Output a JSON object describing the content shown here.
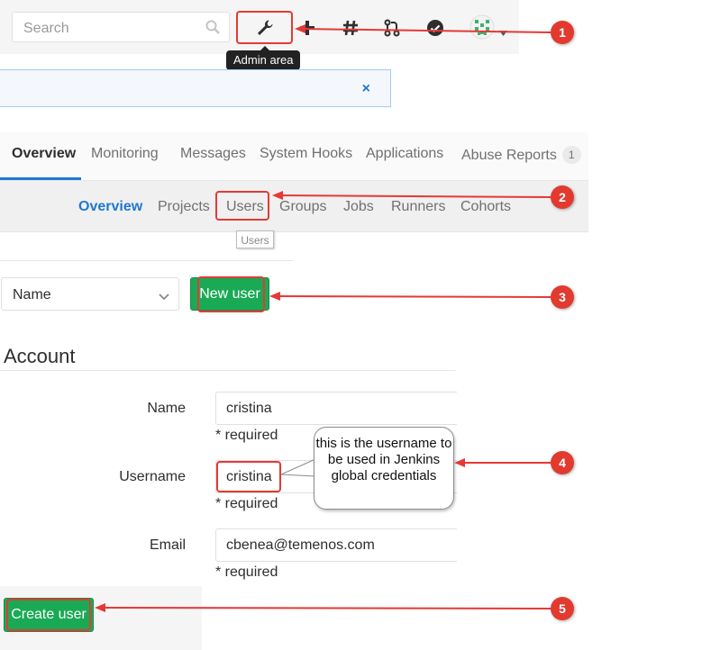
{
  "header": {
    "search_placeholder": "Search",
    "admin_tooltip": "Admin area",
    "icons": [
      "search-icon",
      "wrench-icon",
      "plus-icon",
      "hash-icon",
      "merge-request-icon",
      "todo-check-icon",
      "avatar-icon",
      "caret-down-icon"
    ]
  },
  "alert": {
    "close": "×"
  },
  "tabs": [
    {
      "label": "Overview",
      "active": true
    },
    {
      "label": "Monitoring"
    },
    {
      "label": "Messages"
    },
    {
      "label": "System Hooks"
    },
    {
      "label": "Applications"
    },
    {
      "label": "Abuse Reports",
      "badge": "1"
    }
  ],
  "subtabs": [
    {
      "label": "Overview",
      "active": true
    },
    {
      "label": "Projects"
    },
    {
      "label": "Users"
    },
    {
      "label": "Groups"
    },
    {
      "label": "Jobs"
    },
    {
      "label": "Runners"
    },
    {
      "label": "Cohorts"
    }
  ],
  "users_tooltip": "Users",
  "sort": {
    "selected": "Name"
  },
  "new_user_label": "New user",
  "account": {
    "title": "Account",
    "name_label": "Name",
    "name_value": "cristina",
    "username_label": "Username",
    "username_value": "cristina",
    "email_label": "Email",
    "email_value": "cbenea@temenos.com",
    "required": "* required"
  },
  "create_user_label": "Create user",
  "callout_text": "this is the username to be used in Jenkins global credentials",
  "markers": [
    "1",
    "2",
    "3",
    "4",
    "5"
  ],
  "colors": {
    "annotation": "#e53935",
    "green": "#1aaa55",
    "link": "#1f78d1"
  }
}
